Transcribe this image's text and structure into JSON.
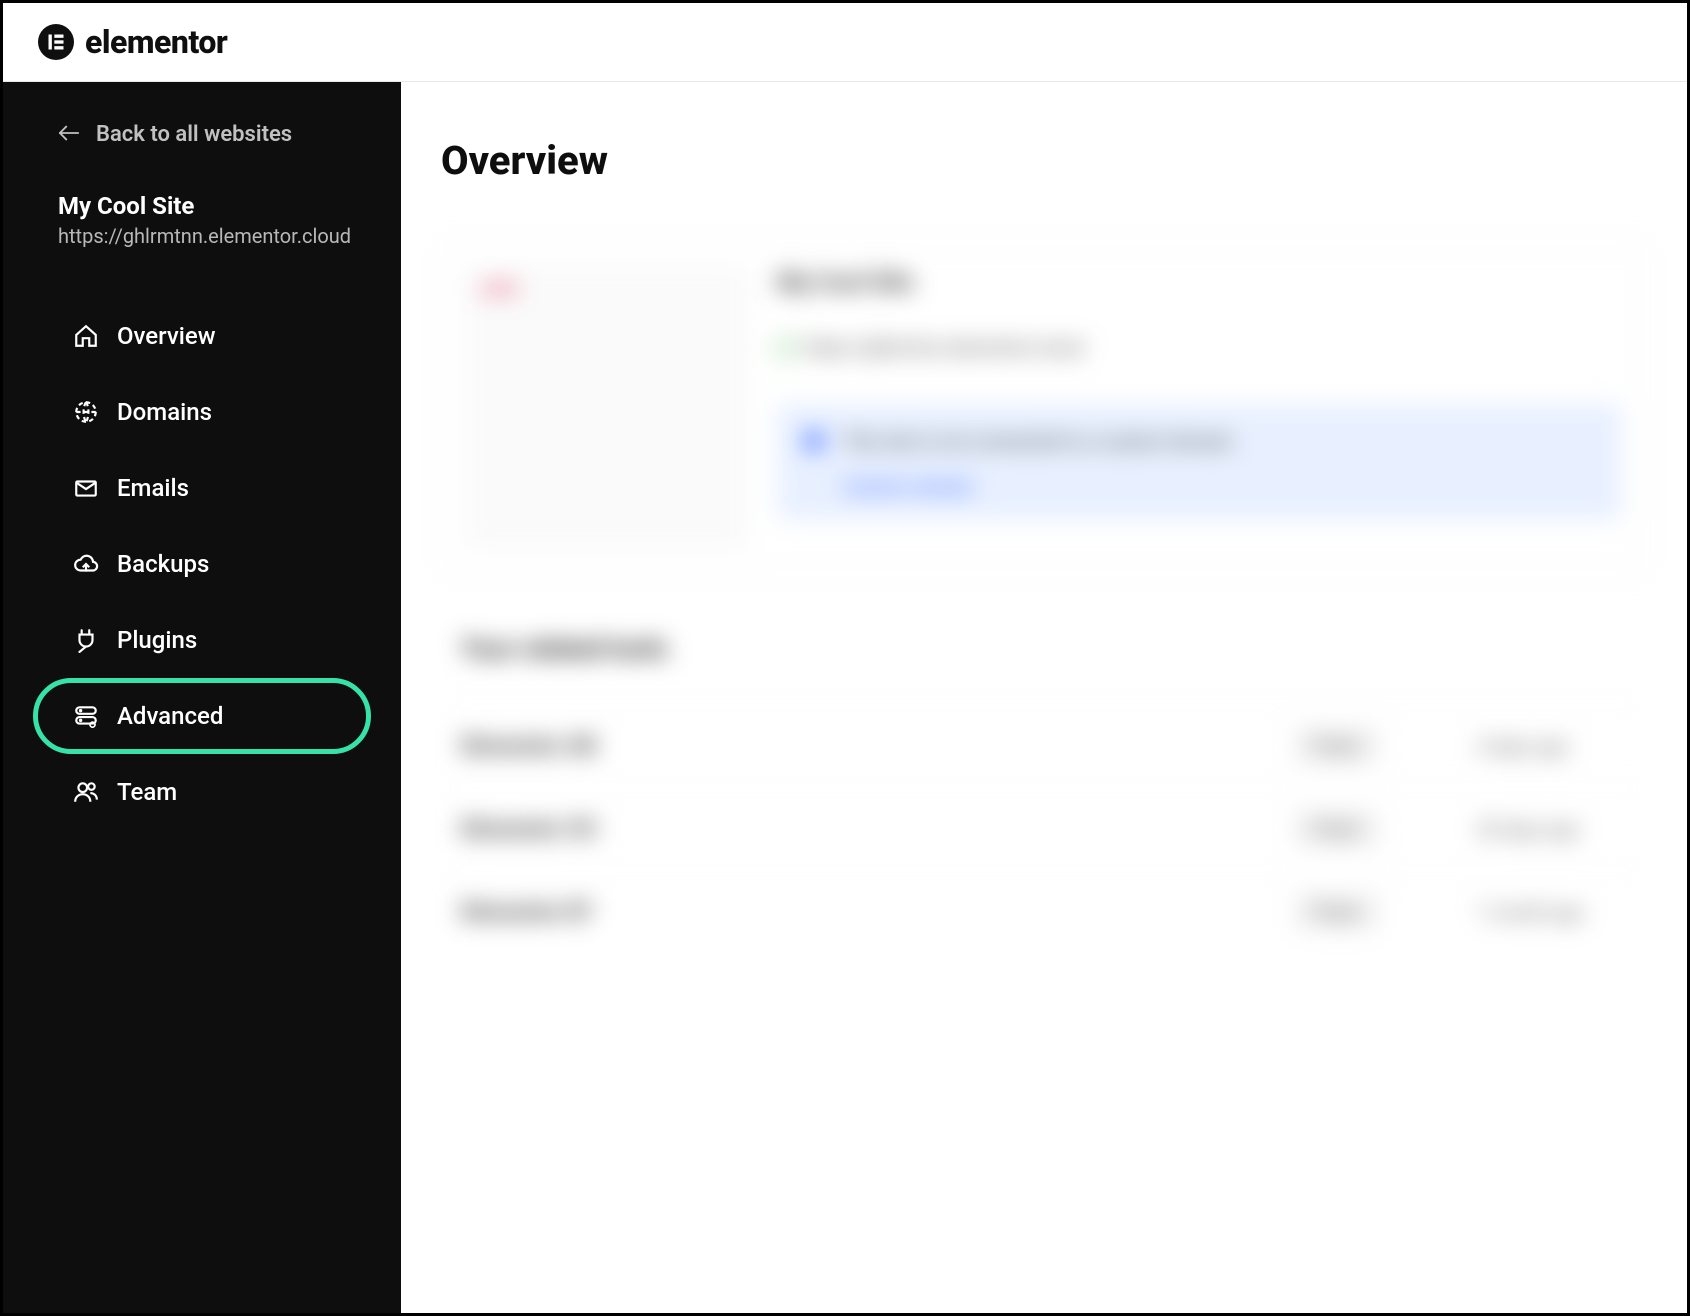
{
  "brand": {
    "logo_letter": "E",
    "logo_text": "elementor"
  },
  "sidebar": {
    "back_label": "Back to all websites",
    "site_name": "My Cool Site",
    "site_url": "https://ghlrmtnn.elementor.cloud",
    "nav": [
      {
        "label": "Overview",
        "icon": "home"
      },
      {
        "label": "Domains",
        "icon": "globe"
      },
      {
        "label": "Emails",
        "icon": "mail"
      },
      {
        "label": "Backups",
        "icon": "cloud"
      },
      {
        "label": "Plugins",
        "icon": "plug"
      },
      {
        "label": "Advanced",
        "icon": "server",
        "highlighted": true
      },
      {
        "label": "Team",
        "icon": "users"
      }
    ]
  },
  "main": {
    "page_title": "Overview",
    "card": {
      "badge": "LIVE",
      "title": "My Cool Site",
      "url": "https://ghlrmtnn.elementor.cloud",
      "notice_text": "This site is not connected to a custom domain",
      "notice_link": "Connect a domain"
    },
    "section_title": "Your related tools",
    "rows": [
      {
        "name": "Elementor AB",
        "badge": "Plugin",
        "time": "4 days ago"
      },
      {
        "name": "Elementor CD",
        "badge": "Plugin",
        "time": "20 days ago"
      },
      {
        "name": "Elementor EF",
        "badge": "Plugin",
        "time": "1 month ago"
      }
    ]
  }
}
